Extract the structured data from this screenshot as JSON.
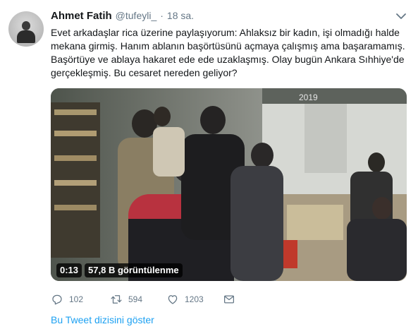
{
  "tweet": {
    "author_name": "Ahmet Fatih",
    "handle": "@tufeyli_",
    "separator": "·",
    "timestamp": "18 sa.",
    "text": "Evet arkadaşlar rica üzerine paylaşıyorum: Ahlaksız bir kadın, işi olmadığı halde mekana girmiş. Hanım ablanın başörtüsünü açmaya çalışmış ama başaramamış. Başörtüye ve ablaya hakaret ede ede uzaklaşmış. Olay bugün Ankara Sıhhiye'de gerçekleşmiş. Bu cesaret nereden geliyor?"
  },
  "video": {
    "duration": "0:13",
    "views": "57,8 B görüntülenme",
    "overlay_text": "2019"
  },
  "actions": {
    "replies": "102",
    "retweets": "594",
    "likes": "1203"
  },
  "thread_link": "Bu Tweet dizisini göster",
  "icons": {
    "caret": "chevron-down-icon",
    "reply": "reply-icon",
    "retweet": "retweet-icon",
    "like": "heart-icon",
    "dm": "envelope-icon"
  },
  "colors": {
    "link": "#1da1f2",
    "secondary_text": "#657786",
    "primary_text": "#14171a"
  }
}
